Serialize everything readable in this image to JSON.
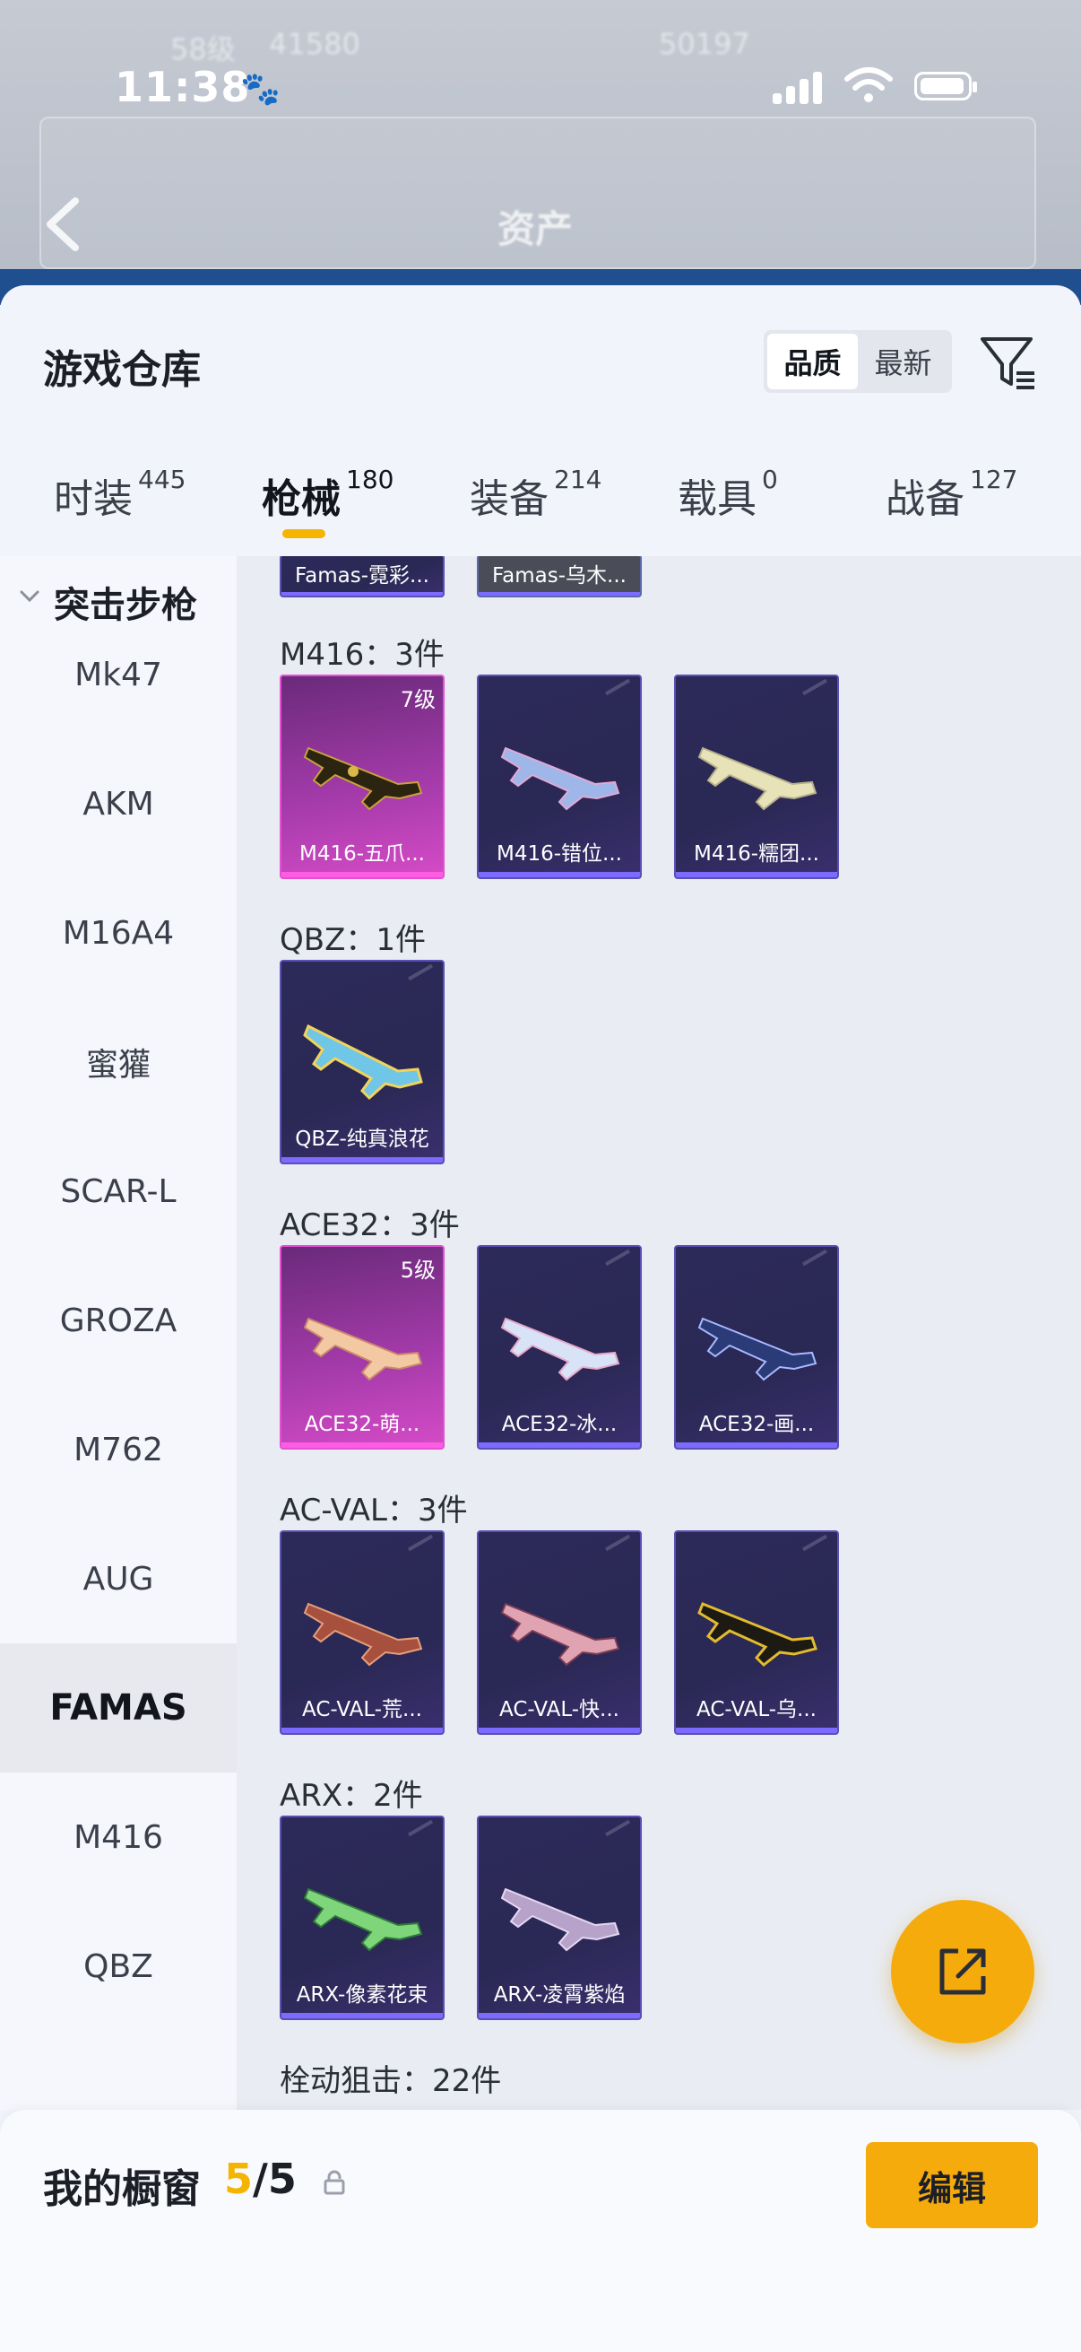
{
  "status": {
    "time": "11:38"
  },
  "background": {
    "title": "资产",
    "ghost_level": "58级",
    "ghost_number": "41580",
    "ghost_number2": "50197"
  },
  "sheet": {
    "title": "游戏仓库"
  },
  "sort": {
    "quality": "品质",
    "latest": "最新"
  },
  "tabs": [
    {
      "label": "时装",
      "count": "445"
    },
    {
      "label": "枪械",
      "count": "180"
    },
    {
      "label": "装备",
      "count": "214"
    },
    {
      "label": "载具",
      "count": "0"
    },
    {
      "label": "战备",
      "count": "127"
    }
  ],
  "sidebar": {
    "group": "突击步枪",
    "items": [
      "Mk47",
      "AKM",
      "M16A4",
      "蜜獾",
      "SCAR-L",
      "GROZA",
      "M762",
      "AUG",
      "FAMAS",
      "M416",
      "QBZ"
    ],
    "active": "FAMAS"
  },
  "content": {
    "top_partial": [
      "Famas-霓彩...",
      "Famas-乌木..."
    ],
    "groups": [
      {
        "title": "M416：3件",
        "cards": [
          {
            "name": "M416-五爪...",
            "level": "7级",
            "rarity": "pink"
          },
          {
            "name": "M416-错位...",
            "level": "",
            "rarity": "purple"
          },
          {
            "name": "M416-糯团...",
            "level": "",
            "rarity": "purple"
          }
        ]
      },
      {
        "title": "QBZ：1件",
        "cards": [
          {
            "name": "QBZ-纯真浪花",
            "level": "",
            "rarity": "purple"
          }
        ]
      },
      {
        "title": "ACE32：3件",
        "cards": [
          {
            "name": "ACE32-萌...",
            "level": "5级",
            "rarity": "pink"
          },
          {
            "name": "ACE32-冰...",
            "level": "",
            "rarity": "purple"
          },
          {
            "name": "ACE32-画...",
            "level": "",
            "rarity": "purple"
          }
        ]
      },
      {
        "title": "AC-VAL：3件",
        "cards": [
          {
            "name": "AC-VAL-荒...",
            "level": "",
            "rarity": "purple"
          },
          {
            "name": "AC-VAL-快...",
            "level": "",
            "rarity": "purple"
          },
          {
            "name": "AC-VAL-乌...",
            "level": "",
            "rarity": "purple"
          }
        ]
      },
      {
        "title": "ARX：2件",
        "cards": [
          {
            "name": "ARX-像素花束",
            "level": "",
            "rarity": "purple"
          },
          {
            "name": "ARX-凌霄紫焰",
            "level": "",
            "rarity": "purple"
          }
        ]
      },
      {
        "title": "栓动狙击：22件",
        "cards": []
      }
    ]
  },
  "showcase": {
    "label": "我的橱窗",
    "current": "5",
    "separator": "/",
    "max": "5",
    "edit": "编辑"
  },
  "colors": {
    "accent": "#f6ab0c",
    "pink_card": "#d54bc7",
    "purple_card": "#2d2a5a"
  }
}
